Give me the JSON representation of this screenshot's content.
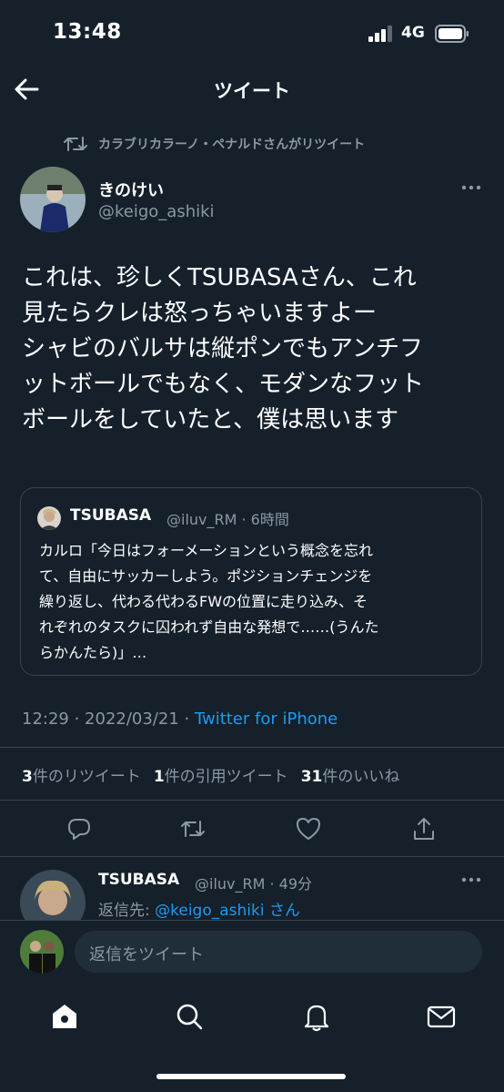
{
  "status_bar": {
    "time": "13:48",
    "network": "4G"
  },
  "header": {
    "title": "ツイート"
  },
  "retweet_context": "カラブリカラーノ・ペナルドさんがリツイート",
  "tweet": {
    "author_name": "きのけい",
    "author_handle": "@keigo_ashiki",
    "text": "これは、珍しくTSUBASAさん、これ\n見たらクレは怒っちゃいますよー\nシャビのバルサは縦ポンでもアンチフ\nットボールでもなく、モダンなフット\nボールをしていたと、僕は思います",
    "timestamp": "12:29 · 2022/03/21 · ",
    "client": "Twitter for iPhone"
  },
  "quote": {
    "name": "TSUBASA",
    "meta": "@iluv_RM · 6時間",
    "text": "カルロ「今日はフォーメーションという概念を忘れ\nて、自由にサッカーしよう。ポジションチェンジを\n繰り返し、代わる代わるFWの位置に走り込み、そ\nれぞれのタスクに囚われず自由な発想で……(うんた\nらかんたら)」…"
  },
  "stats": {
    "retweets_count": "3",
    "retweets_label": "件のリツイート",
    "quotes_count": "1",
    "quotes_label": "件の引用ツイート",
    "likes_count": "31",
    "likes_label": "件のいいね"
  },
  "reply": {
    "name": "TSUBASA",
    "meta": "@iluv_RM · 49分",
    "replying_label": "返信先: ",
    "replying_to": "@keigo_ashiki",
    "replying_suffix": " さん"
  },
  "compose": {
    "placeholder": "返信をツイート"
  },
  "colors": {
    "background": "#15202b",
    "accent": "#1d9bf0",
    "muted": "#8b98a5",
    "border": "#38444d"
  },
  "icons": [
    "back-arrow-icon",
    "retweet-icon",
    "more-icon",
    "reply-icon",
    "like-icon",
    "share-icon",
    "home-icon",
    "search-icon",
    "notifications-icon",
    "messages-icon"
  ]
}
